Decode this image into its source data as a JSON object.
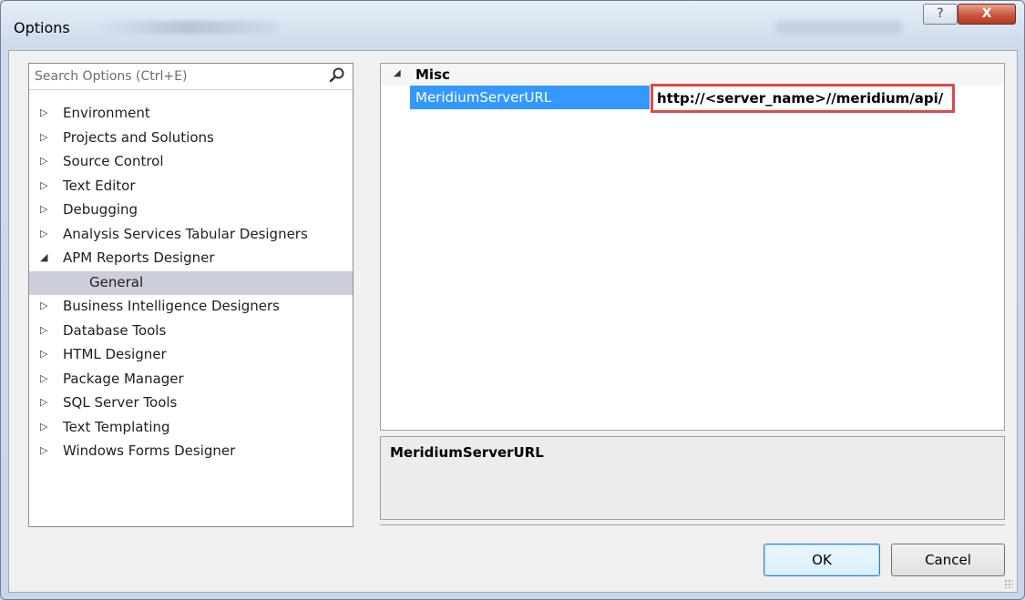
{
  "window": {
    "title": "Options",
    "help_glyph": "?",
    "close_glyph": "X"
  },
  "search": {
    "placeholder": "Search Options (Ctrl+E)",
    "icon": "search-icon"
  },
  "tree": {
    "items": [
      {
        "label": "Environment",
        "expanded": false
      },
      {
        "label": "Projects and Solutions",
        "expanded": false
      },
      {
        "label": "Source Control",
        "expanded": false
      },
      {
        "label": "Text Editor",
        "expanded": false
      },
      {
        "label": "Debugging",
        "expanded": false
      },
      {
        "label": "Analysis Services Tabular Designers",
        "expanded": false
      },
      {
        "label": "APM Reports Designer",
        "expanded": true
      },
      {
        "label": "General",
        "child": true,
        "selected": true
      },
      {
        "label": "Business Intelligence Designers",
        "expanded": false
      },
      {
        "label": "Database Tools",
        "expanded": false
      },
      {
        "label": "HTML Designer",
        "expanded": false
      },
      {
        "label": "Package Manager",
        "expanded": false
      },
      {
        "label": "SQL Server Tools",
        "expanded": false
      },
      {
        "label": "Text Templating",
        "expanded": false
      },
      {
        "label": "Windows Forms Designer",
        "expanded": false
      }
    ]
  },
  "property_grid": {
    "category": "Misc",
    "property_name": "MeridiumServerURL",
    "property_value": "http://<server_name>//meridium/api/",
    "highlight_color": "#e04848",
    "selection_color": "#3399ff"
  },
  "description": {
    "title": "MeridiumServerURL"
  },
  "buttons": {
    "ok": "OK",
    "cancel": "Cancel"
  }
}
